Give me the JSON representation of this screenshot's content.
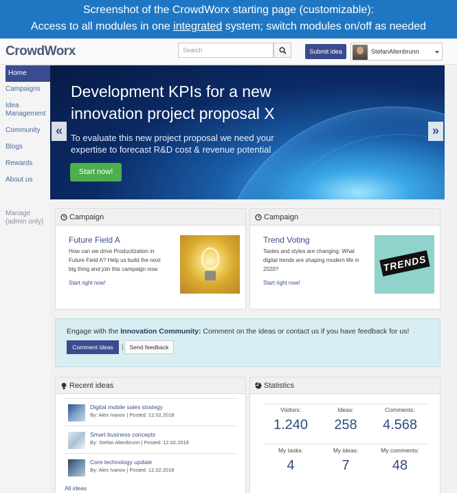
{
  "caption": {
    "line1": "Screenshot of the CrowdWorx starting page (customizable):",
    "line2_pre": "Access to all modules in one ",
    "line2_underlined": "integrated",
    "line2_post": " system; switch modules on/off as needed"
  },
  "header": {
    "logo": "CrowdWorx",
    "search_placeholder": "Search",
    "submit_label": "Submit idea",
    "user_name": "StefanAltenbrunn"
  },
  "sidebar": {
    "items": [
      {
        "label": "Home"
      },
      {
        "label": "Campaigns"
      },
      {
        "label": "Idea Management"
      },
      {
        "label": "Community"
      },
      {
        "label": "Blogs"
      },
      {
        "label": "Rewards"
      },
      {
        "label": "About us"
      }
    ],
    "manage": "Manage (admin only)"
  },
  "hero": {
    "title_line1": "Development KPIs for a new",
    "title_line2": "innovation project proposal X",
    "sub_line1": "To evaluate this new project proposal we need your",
    "sub_line2": "expertise to forecast R&D cost & revenue potential",
    "cta": "Start now!",
    "prev": "«",
    "next": "»"
  },
  "campaigns": [
    {
      "header": "Campaign",
      "title": "Future Field A",
      "text_lines": [
        "How can we drive Productization in",
        "Future Field A? Help us build the next",
        "big thing and join this campaign now."
      ],
      "link": "Start right now!"
    },
    {
      "header": "Campaign",
      "title": "Trend Voting",
      "text_lines": [
        "Tastes and styles are changing: What",
        "digital trends are shaping modern life in",
        "2020?"
      ],
      "link": "Start right now!",
      "image_text": "TRENDS"
    }
  ],
  "engage": {
    "pre": "Engage with the ",
    "bold": "Innovation Community:",
    "post": " Comment on the ideas or contact us if you have feedback for us!",
    "comment_btn": "Comment ideas",
    "separator": "|",
    "feedback_btn": "Send feedback"
  },
  "recent_ideas": {
    "header": "Recent ideas",
    "items": [
      {
        "title": "Digital mobile sales strategy",
        "meta": "By: Alex Ivanov | Posted: 12.02.2018"
      },
      {
        "title": "Smart business concepts",
        "meta": "By: Stefan Altenbrunn | Posted: 12.02.2018"
      },
      {
        "title": "Core technology update",
        "meta": "By: Alex Ivanov | Posted: 12.02.2018"
      }
    ],
    "all_link": "All ideas"
  },
  "statistics": {
    "header": "Statistics",
    "top": [
      {
        "label": "Visitors:",
        "value": "1.240"
      },
      {
        "label": "Ideas:",
        "value": "258"
      },
      {
        "label": "Comments:",
        "value": "4.568"
      }
    ],
    "bottom": [
      {
        "label": "My tasks:",
        "value": "4"
      },
      {
        "label": "My ideas:",
        "value": "7"
      },
      {
        "label": "My comments:",
        "value": "48"
      }
    ]
  },
  "colors": {
    "accent": "#3b4b8f",
    "banner": "#1f77c4",
    "cta_green": "#4cae4c",
    "engage_bg": "#d8eef2"
  }
}
